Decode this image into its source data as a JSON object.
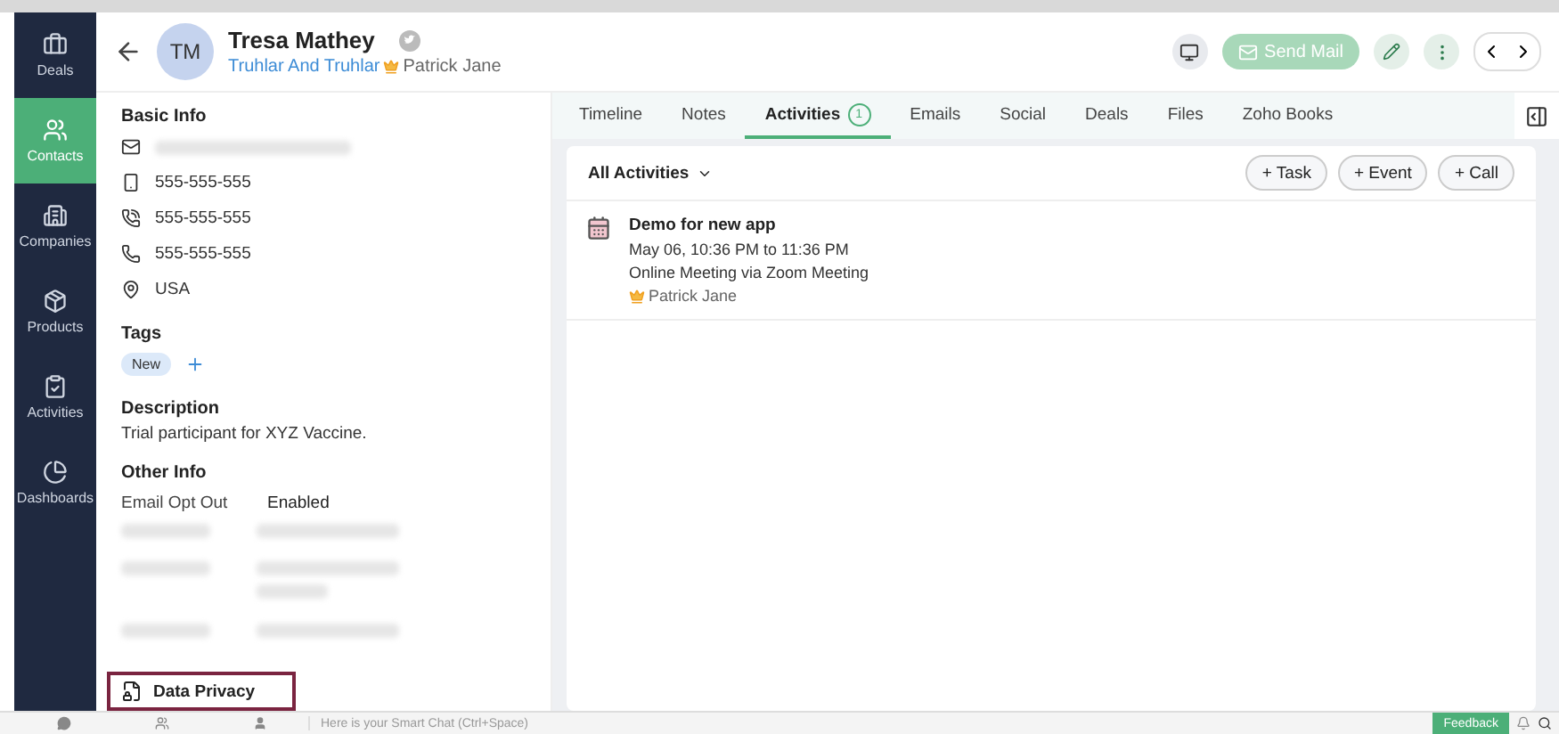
{
  "nav": [
    {
      "label": "Deals",
      "selected": false
    },
    {
      "label": "Contacts",
      "selected": true
    },
    {
      "label": "Companies",
      "selected": false
    },
    {
      "label": "Products",
      "selected": false
    },
    {
      "label": "Activities",
      "selected": false
    },
    {
      "label": "Dashboards",
      "selected": false
    }
  ],
  "contact": {
    "initials": "TM",
    "name": "Tresa Mathey",
    "company": "Truhlar And Truhlar",
    "owner": "Patrick Jane"
  },
  "header_actions": {
    "send_mail": "Send Mail"
  },
  "basic_info": {
    "title": "Basic Info",
    "rows": [
      {
        "kind": "email"
      },
      {
        "kind": "mobile",
        "value": "555-555-555"
      },
      {
        "kind": "phone",
        "value": "555-555-555"
      },
      {
        "kind": "landline",
        "value": "555-555-555"
      },
      {
        "kind": "location",
        "value": "USA"
      }
    ]
  },
  "tags": {
    "title": "Tags",
    "items": [
      "New"
    ]
  },
  "description": {
    "title": "Description",
    "text": "Trial participant for XYZ Vaccine."
  },
  "other_info": {
    "title": "Other Info",
    "rows": [
      {
        "kind": "field",
        "label": "Email Opt Out",
        "value": "Enabled"
      },
      {
        "kind": "blurred"
      },
      {
        "kind": "blurred_long"
      },
      {
        "kind": "blurred"
      }
    ]
  },
  "data_privacy": {
    "label": "Data Privacy"
  },
  "tabs": [
    {
      "label": "Timeline",
      "selected": false
    },
    {
      "label": "Notes",
      "selected": false
    },
    {
      "label": "Activities",
      "badge": "1",
      "selected": true
    },
    {
      "label": "Emails",
      "selected": false
    },
    {
      "label": "Social",
      "selected": false
    },
    {
      "label": "Deals",
      "selected": false
    },
    {
      "label": "Files",
      "selected": false
    },
    {
      "label": "Zoho Books",
      "selected": false
    }
  ],
  "activities": {
    "filter": "All Activities",
    "buttons": [
      "+ Task",
      "+ Event",
      "+ Call"
    ],
    "items": [
      {
        "title": "Demo for new app",
        "time": "May 06, 10:36 PM to 11:36 PM",
        "detail": "Online Meeting via Zoom Meeting",
        "owner": "Patrick Jane"
      }
    ]
  },
  "bottom_bar": {
    "chat_placeholder": "Here is your Smart Chat (Ctrl+Space)",
    "feedback": "Feedback"
  }
}
